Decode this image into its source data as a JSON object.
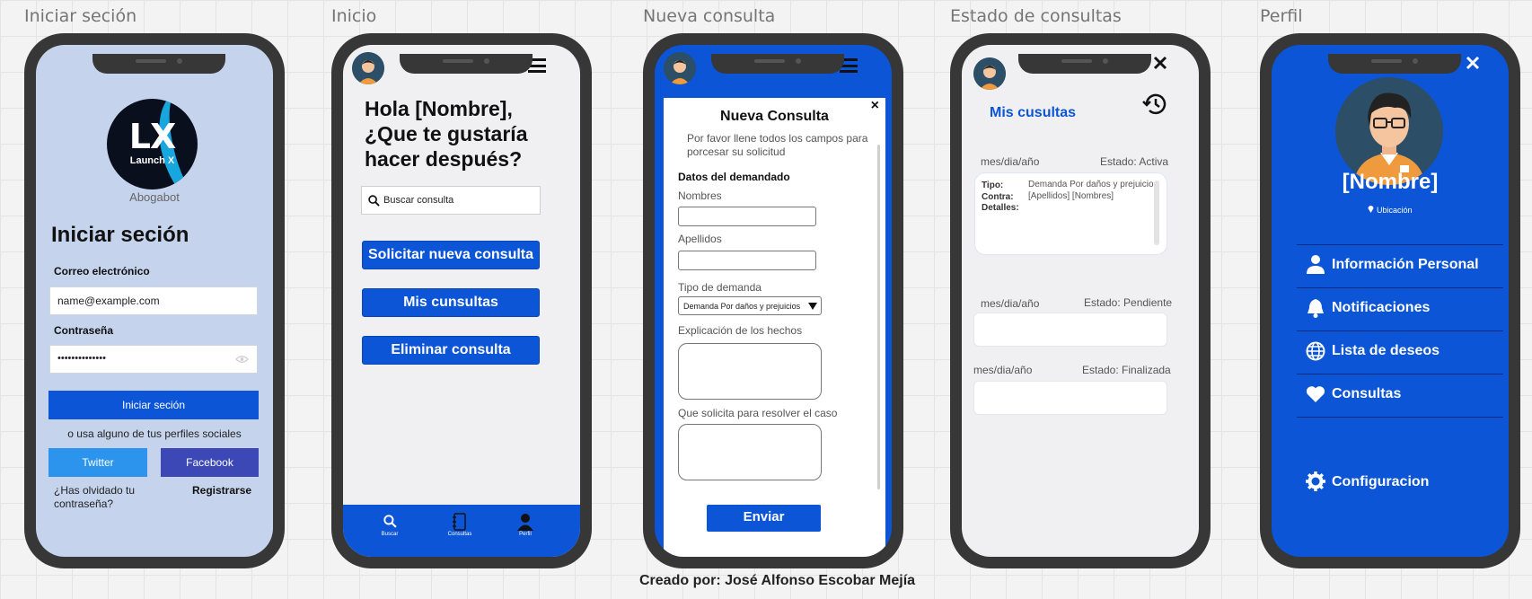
{
  "screens": {
    "login": {
      "title": "Iniciar seción",
      "app_name": "Abogabot",
      "logo_big": "LX",
      "logo_small": "Launch X",
      "heading": "Iniciar seción",
      "email_label": "Correo electrónico",
      "email_value": "name@example.com",
      "password_label": "Contraseña",
      "password_value": "••••••••••••••",
      "login_button": "Iniciar seción",
      "social_text": "o usa alguno de tus perfiles sociales",
      "twitter": "Twitter",
      "facebook": "Facebook",
      "forgot": "¿Has olvidado tu contraseña?",
      "register": "Registrarse"
    },
    "home": {
      "title": "Inicio",
      "greeting": "Hola [Nombre], ¿Que te gustaría hacer después?",
      "search_placeholder": "Buscar consulta",
      "btn_new": "Solicitar nueva consulta",
      "btn_mine": "Mis cunsultas",
      "btn_delete": "Eliminar consulta",
      "nav": [
        "Buscar",
        "Consultas",
        "Perfil"
      ]
    },
    "new": {
      "title": "Nueva consulta",
      "modal_title": "Nueva Consulta",
      "close": "×",
      "instructions": "Por favor llene todos los campos para porcesar su solicitud",
      "section": "Datos del demandado",
      "names_label": "Nombres",
      "surnames_label": "Apellidos",
      "type_label": "Tipo de demanda",
      "type_value": "Demanda Por daños y prejuicios",
      "facts_label": "Explicación de los hechos",
      "request_label": "Que solicita para resolver el caso",
      "submit": "Enviar"
    },
    "status": {
      "title": "Estado de consultas",
      "heading": "Mis cusultas",
      "cards": [
        {
          "date": "mes/dia/año",
          "status": "Estado: Activa",
          "tipo_label": "Tipo:",
          "tipo": "Demanda Por daños y prejuicios",
          "contra_label": "Contra:",
          "contra": "[Apellidos] [Nombres]",
          "detalles_label": "Detalles:"
        },
        {
          "date": "mes/dia/año",
          "status": "Estado: Pendiente"
        },
        {
          "date": "mes/dia/año",
          "status": "Estado: Finalizada"
        }
      ]
    },
    "profile": {
      "title": "Perfil",
      "name": "[Nombre]",
      "location": "Ubicación",
      "items": [
        "Información Personal",
        "Notificaciones",
        "Lista de deseos",
        "Consultas"
      ],
      "settings": "Configuracion"
    }
  },
  "credit": "Creado por: José Alfonso Escobar Mejía",
  "colors": {
    "primary": "#0b55d6",
    "login_bg": "#c5d4ec",
    "twitter": "#2c94ec",
    "facebook": "#3b48b6",
    "phone_frame": "#373737"
  }
}
